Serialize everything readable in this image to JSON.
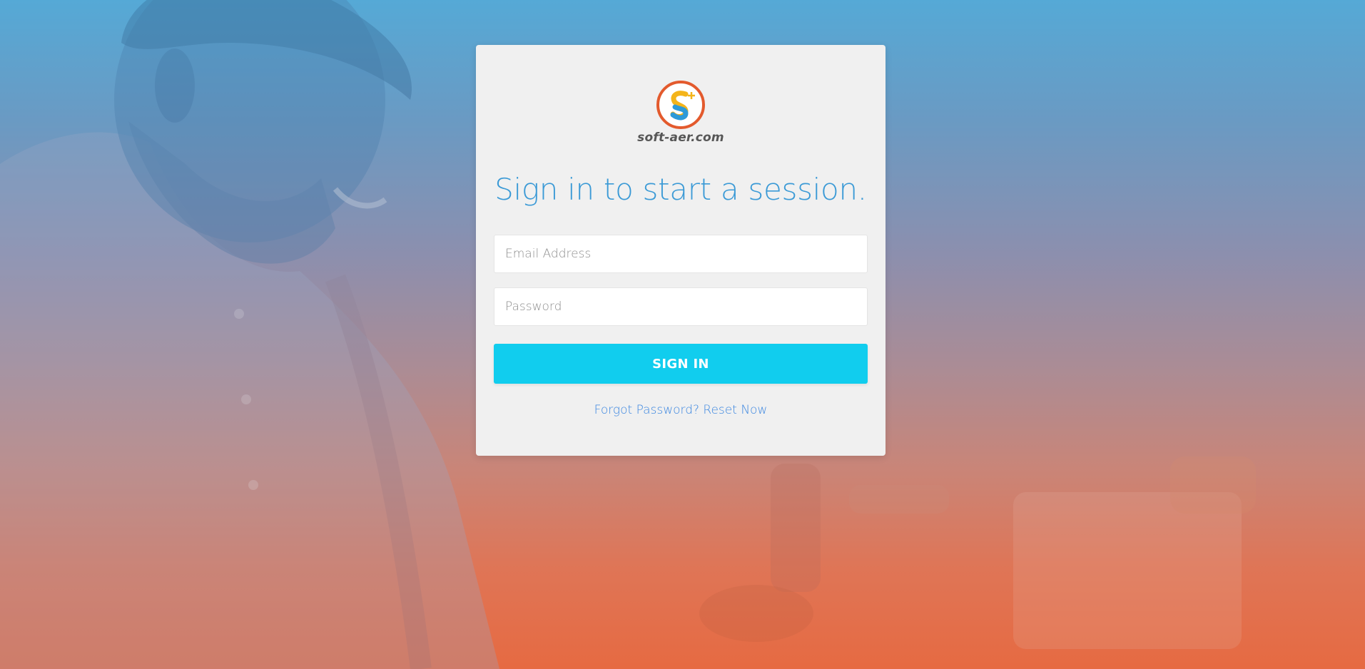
{
  "brand": {
    "logo_text": "soft-aer.com",
    "accent_ring": "#e35a2d",
    "accent_s_blue": "#2d9ad8",
    "accent_s_yellow": "#f4b41a"
  },
  "login": {
    "headline": "Sign in to start a session.",
    "email_placeholder": "Email Address",
    "password_placeholder": "Password",
    "sign_in_label": "SIGN IN",
    "forgot_label": "Forgot Password? Reset Now"
  },
  "colors": {
    "button": "#11cdee",
    "headline": "#3b9ad6",
    "link": "#3b86e0",
    "card": "#f0f0f0"
  }
}
